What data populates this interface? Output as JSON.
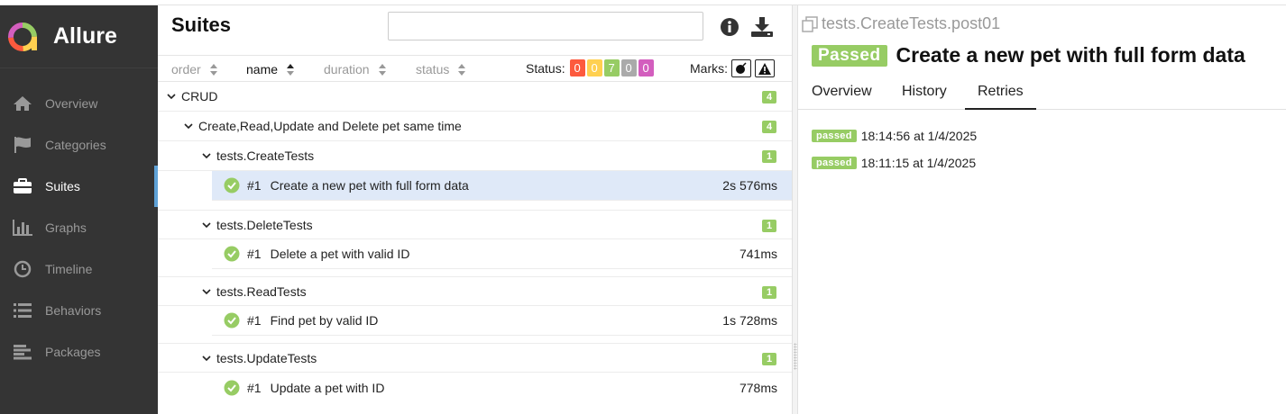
{
  "brand": {
    "name": "Allure"
  },
  "sidebar": {
    "items": [
      {
        "label": "Overview",
        "icon": "home-icon"
      },
      {
        "label": "Categories",
        "icon": "flag-icon"
      },
      {
        "label": "Suites",
        "icon": "briefcase-icon",
        "active": true
      },
      {
        "label": "Graphs",
        "icon": "bar-chart-icon"
      },
      {
        "label": "Timeline",
        "icon": "clock-icon"
      },
      {
        "label": "Behaviors",
        "icon": "list-icon"
      },
      {
        "label": "Packages",
        "icon": "align-left-icon"
      }
    ]
  },
  "suites": {
    "title": "Suites",
    "search_value": "",
    "sort": {
      "order": "order",
      "name": "name",
      "duration": "duration",
      "status": "status"
    },
    "status_filter": {
      "label": "Status:",
      "counts": [
        {
          "value": "0",
          "color": "#fd5a3e"
        },
        {
          "value": "0",
          "color": "#ffd050"
        },
        {
          "value": "7",
          "color": "#97cc64"
        },
        {
          "value": "0",
          "color": "#aaaaaa"
        },
        {
          "value": "0",
          "color": "#d35ebe"
        }
      ]
    },
    "marks_label": "Marks:",
    "tree": {
      "root": {
        "name": "CRUD",
        "count": "4"
      },
      "group": {
        "name": "Create,Read,Update and Delete pet same time",
        "count": "4"
      },
      "classes": [
        {
          "name": "tests.CreateTests",
          "count": "1",
          "test": {
            "num": "#1",
            "name": "Create a new pet with full form data",
            "duration": "2s 576ms"
          }
        },
        {
          "name": "tests.DeleteTests",
          "count": "1",
          "test": {
            "num": "#1",
            "name": "Delete a pet with valid ID",
            "duration": "741ms"
          }
        },
        {
          "name": "tests.ReadTests",
          "count": "1",
          "test": {
            "num": "#1",
            "name": "Find pet by valid ID",
            "duration": "1s 728ms"
          }
        },
        {
          "name": "tests.UpdateTests",
          "count": "1",
          "test": {
            "num": "#1",
            "name": "Update a pet with ID",
            "duration": "778ms"
          }
        }
      ]
    }
  },
  "detail": {
    "crumb": "tests.CreateTests.post01",
    "status_badge": "Passed",
    "title": "Create a new pet with full form data",
    "tabs": [
      "Overview",
      "History",
      "Retries"
    ],
    "active_tab": "Retries",
    "retries": [
      {
        "status": "passed",
        "time": "18:14:56 at 1/4/2025"
      },
      {
        "status": "passed",
        "time": "18:11:15 at 1/4/2025"
      }
    ]
  },
  "colors": {
    "passed": "#97cc64",
    "sidebar": "#343434",
    "accent": "#5fa2d7"
  }
}
